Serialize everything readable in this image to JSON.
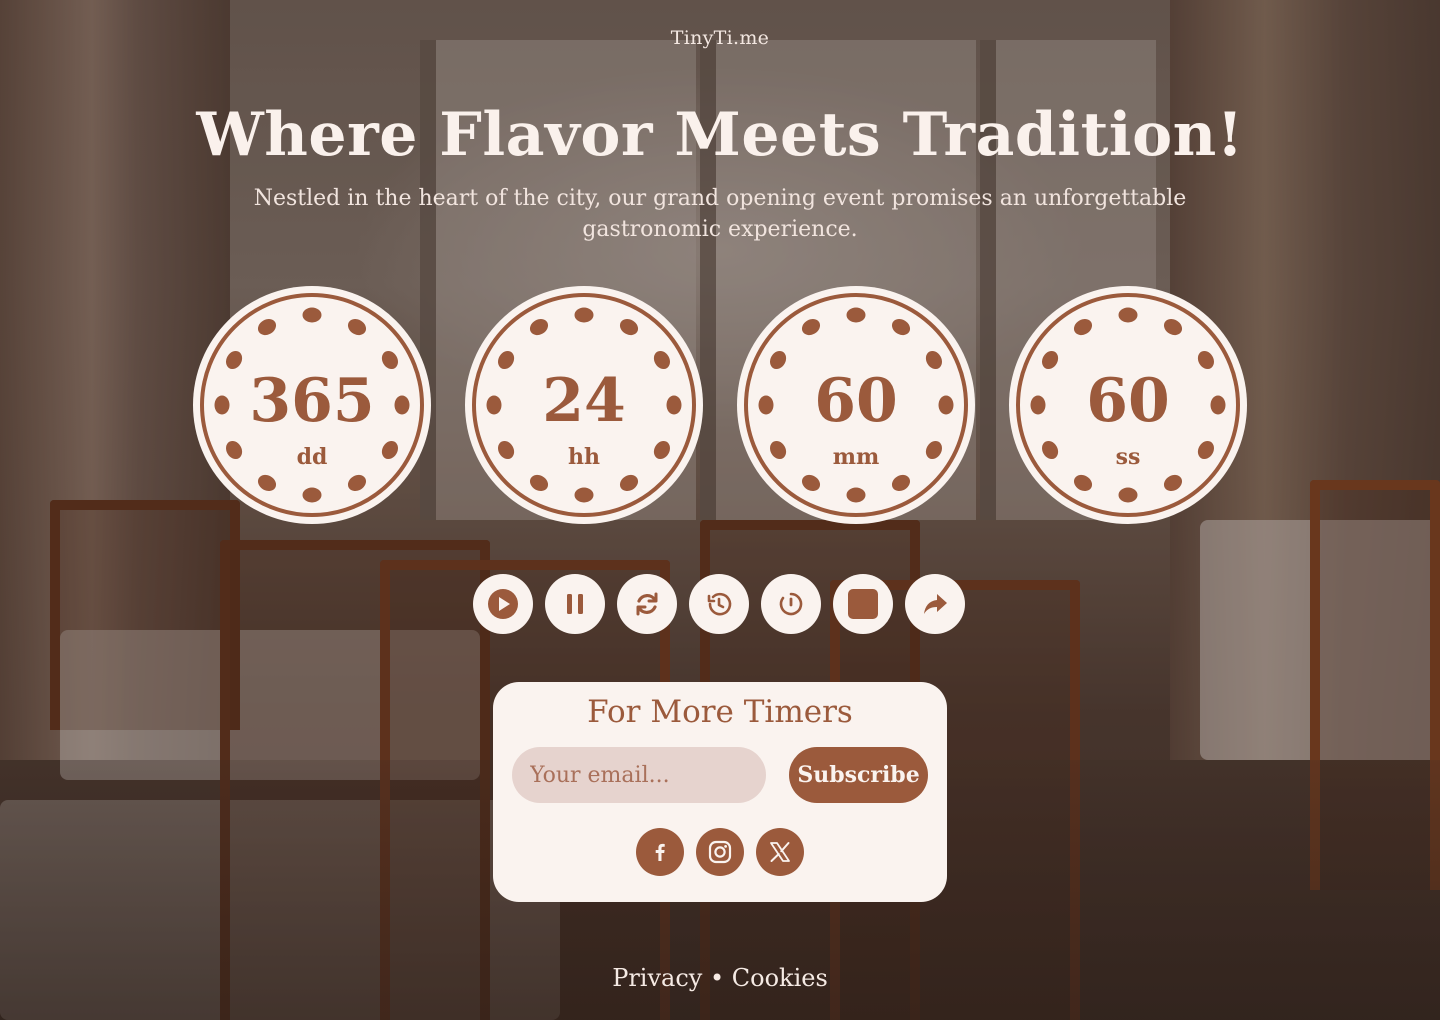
{
  "brand": "TinyTi.me",
  "hero": {
    "title": "Where Flavor Meets Tradition!",
    "subtitle": "Nestled in the heart of the city, our grand opening event promises an unforgettable gastronomic experience."
  },
  "countdown": [
    {
      "value": "365",
      "unit": "dd"
    },
    {
      "value": "24",
      "unit": "hh"
    },
    {
      "value": "60",
      "unit": "mm"
    },
    {
      "value": "60",
      "unit": "ss"
    }
  ],
  "controls": [
    "play-icon",
    "pause-icon",
    "refresh-icon",
    "history-icon",
    "timer-icon",
    "stop-icon",
    "share-icon"
  ],
  "subscribe": {
    "title": "For More Timers",
    "email_placeholder": "Your email...",
    "button_label": "Subscribe",
    "socials": [
      "facebook-icon",
      "instagram-icon",
      "x-icon"
    ]
  },
  "footer": {
    "privacy": "Privacy",
    "separator": "•",
    "cookies": "Cookies"
  },
  "colors": {
    "accent": "#9b5a3c",
    "card": "#faf3ef",
    "input_bg": "#e6d3ce"
  }
}
